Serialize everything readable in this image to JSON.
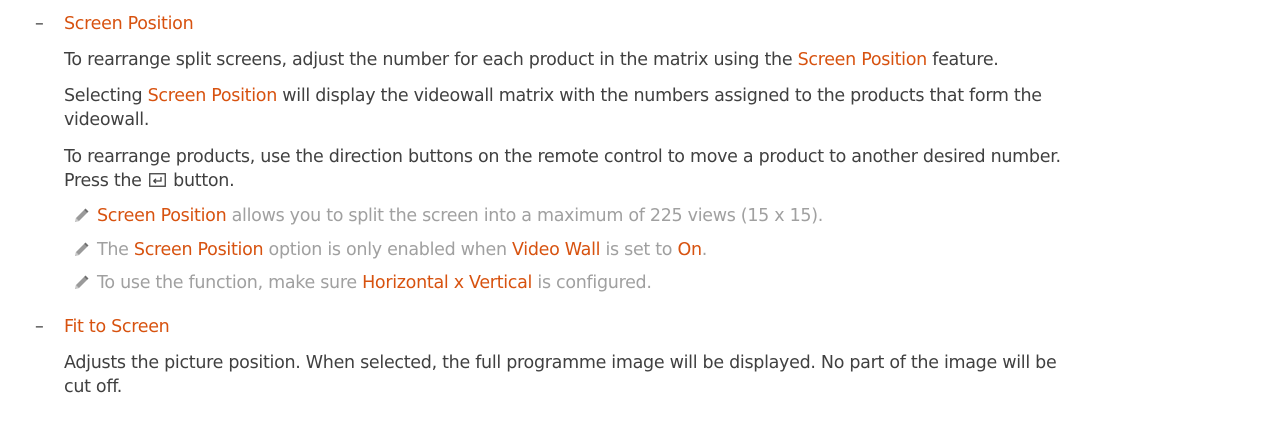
{
  "section1": {
    "dash": "–",
    "title": "Screen Position",
    "p1": {
      "t1": "To rearrange split screens, adjust the number for each product in the matrix using the ",
      "hl": "Screen Position",
      "t2": " feature."
    },
    "p2": {
      "t0": "Selecting ",
      "hl": "Screen Position",
      "t1": " will display the videowall matrix with the numbers assigned to the products that form the",
      "line2": "videowall."
    },
    "p3": {
      "line1": "To rearrange products, use the direction buttons on the remote control to move a product to another desired number.",
      "t_before": "Press the ",
      "icon": "enter-button-icon",
      "t_after": " button."
    },
    "notes": [
      {
        "icon": "pencil-note-icon",
        "hl1": "Screen Position",
        "t1": " allows you to split the screen into a maximum of 225 views (15 x 15)."
      },
      {
        "icon": "pencil-note-icon",
        "t0": "The ",
        "hl1": "Screen Position",
        "t1": " option is only enabled when ",
        "hl2": "Video Wall",
        "t2": " is set to ",
        "hl3": "On",
        "t3": "."
      },
      {
        "icon": "pencil-note-icon",
        "t0": "To use the function, make sure ",
        "hl1": "Horizontal x Vertical",
        "t1": " is configured."
      }
    ]
  },
  "section2": {
    "dash": "–",
    "title": "Fit to Screen",
    "line1": "Adjusts the picture position. When selected, the full programme image will be displayed. No part of the image will be",
    "line2": "cut off."
  },
  "colors": {
    "accent": "#d7520f",
    "body_text": "#404040",
    "note_text": "#a0a0a0"
  }
}
